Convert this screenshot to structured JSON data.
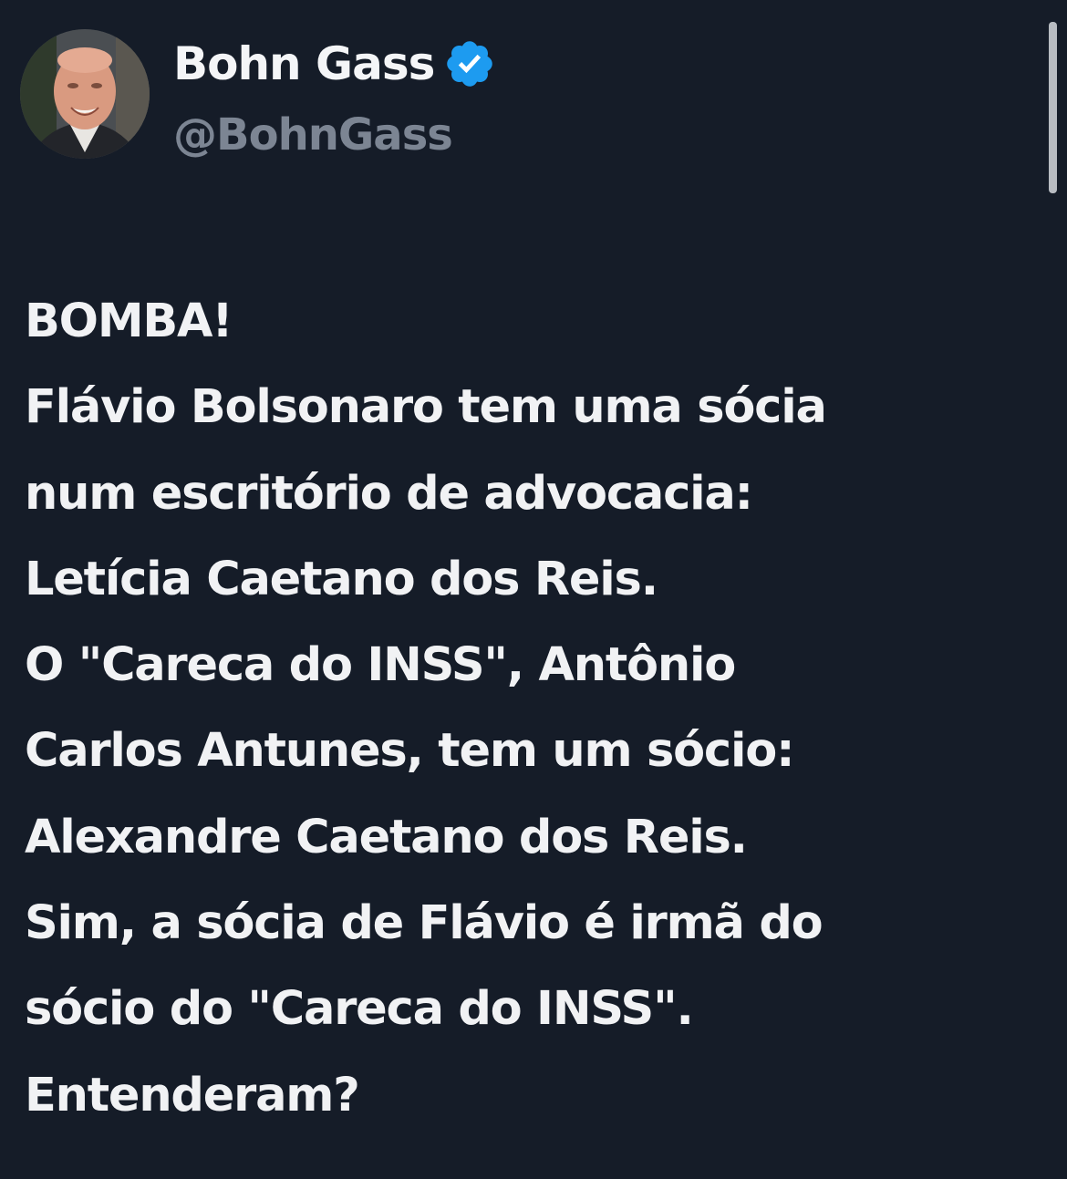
{
  "author": {
    "display_name": "Bohn Gass",
    "handle": "@BohnGass",
    "verified": true,
    "verified_color": "#1d9bf0",
    "avatar_icon": "profile-photo"
  },
  "tweet": {
    "lines": [
      "BOMBA!",
      "Flávio Bolsonaro tem uma sócia",
      "num escritório de advocacia:",
      "Letícia Caetano dos Reis.",
      "O \"Careca do INSS\", Antônio",
      "Carlos Antunes, tem um sócio:",
      "Alexandre Caetano dos Reis.",
      "Sim, a sócia de Flávio é irmã do",
      "sócio do \"Careca do INSS\".",
      "Entenderam?"
    ]
  },
  "colors": {
    "background": "#151c28",
    "text": "#f1f2f4",
    "handle": "#7c8593"
  }
}
